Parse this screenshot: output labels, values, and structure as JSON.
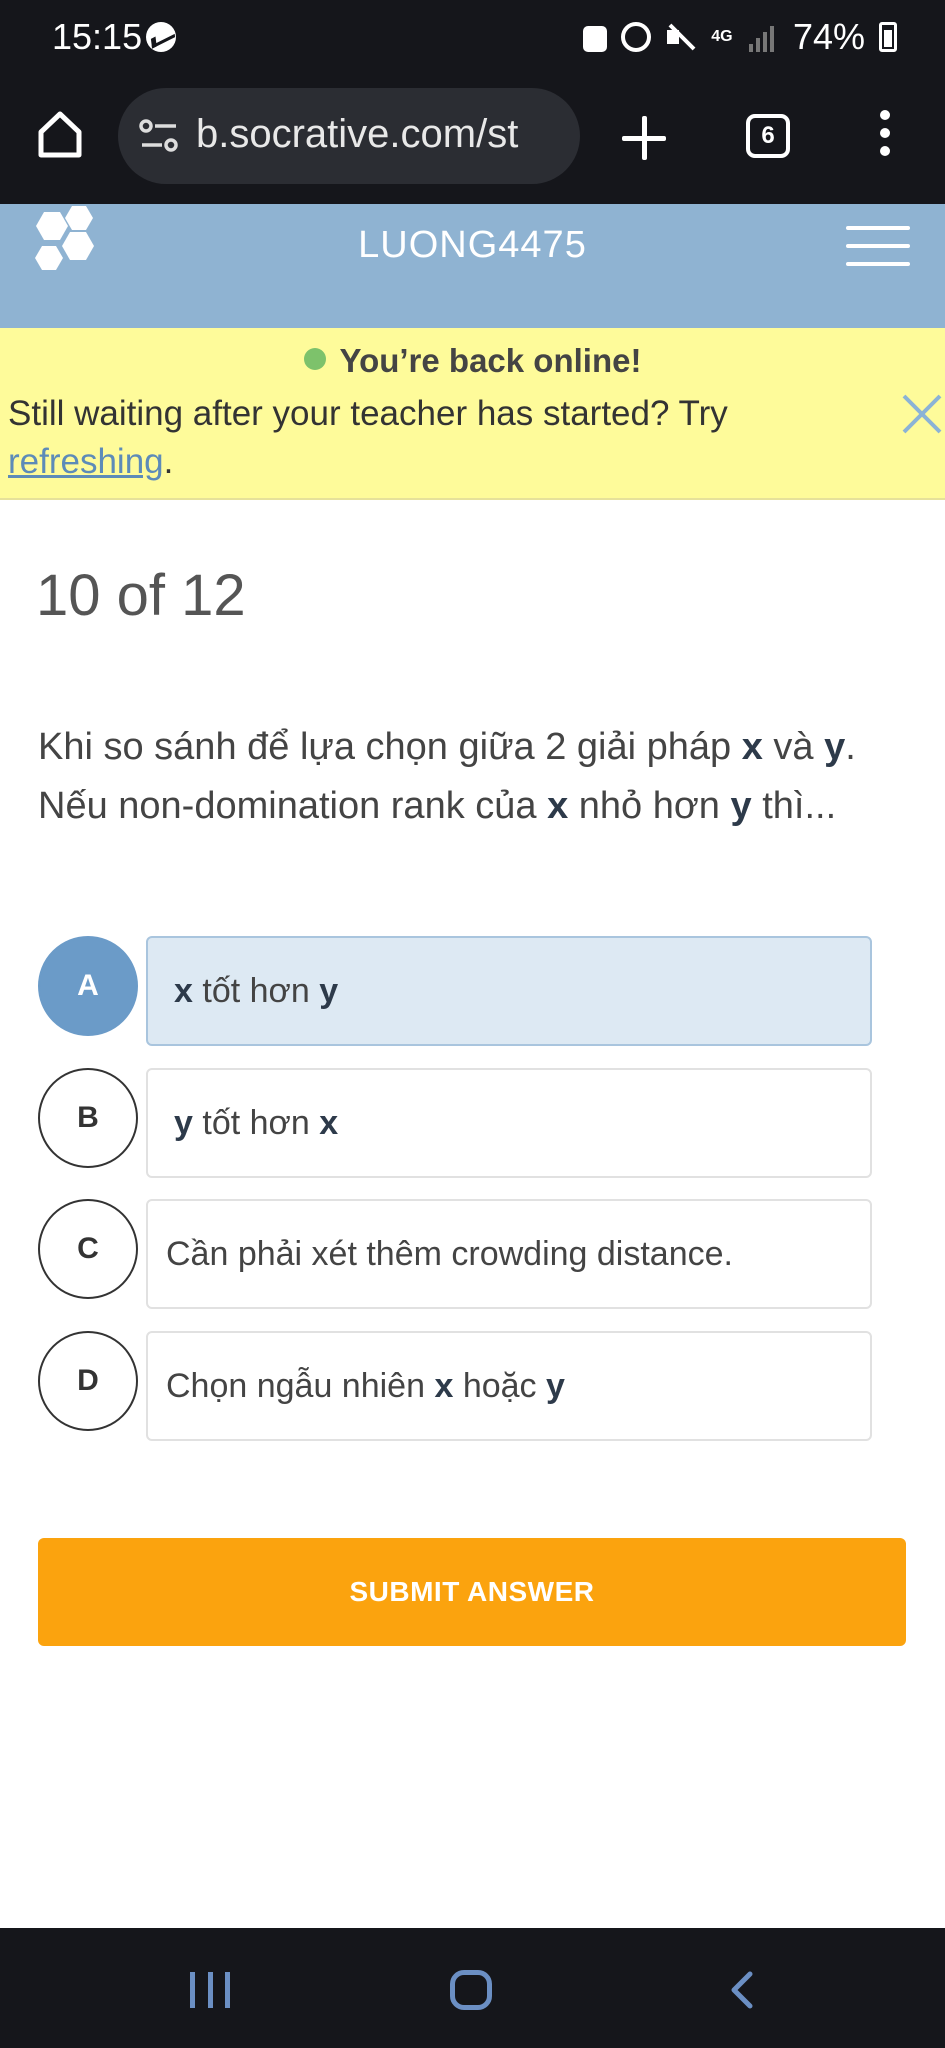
{
  "status_bar": {
    "time": "15:15",
    "network": "4G",
    "battery": "74%"
  },
  "browser": {
    "url": "b.socrative.com/st",
    "tab_count": "6"
  },
  "header": {
    "room_name": "LUONG4475"
  },
  "banner": {
    "title": "You’re back online!",
    "message": "Still waiting after your teacher has started? Try ",
    "link_text": "refreshing",
    "message_end": "."
  },
  "quiz": {
    "progress": "10 of 12",
    "question": {
      "p1": "Khi so sánh để lựa chọn giữa 2 giải pháp ",
      "x1": "x",
      "p2": " và ",
      "y1": "y",
      "p3": ". Nếu non-domination rank của  ",
      "x2": "x",
      "p4": " nhỏ hơn ",
      "y2": "y",
      "p5": " thì..."
    },
    "choices": [
      {
        "letter": "A",
        "pre": "",
        "b1": "x",
        "mid": " tốt hơn ",
        "b2": "y",
        "selected": true
      },
      {
        "letter": "B",
        "pre": "",
        "b1": "y",
        "mid": " tốt hơn ",
        "b2": "x",
        "selected": false
      },
      {
        "letter": "C",
        "pre": "Cần phải xét thêm crowding distance.",
        "b1": "",
        "mid": "",
        "b2": "",
        "selected": false
      },
      {
        "letter": "D",
        "pre": "Chọn ngẫu nhiên  ",
        "b1": "x",
        "mid": " hoặc ",
        "b2": "y",
        "selected": false
      }
    ],
    "submit_label": "SUBMIT ANSWER"
  },
  "colors": {
    "header": "#8fb3d2",
    "banner": "#fefb9a",
    "online_dot": "#7dc26b",
    "selected_letter": "#6b9bc8",
    "selected_box": "#dde9f3",
    "submit": "#fba30e"
  }
}
